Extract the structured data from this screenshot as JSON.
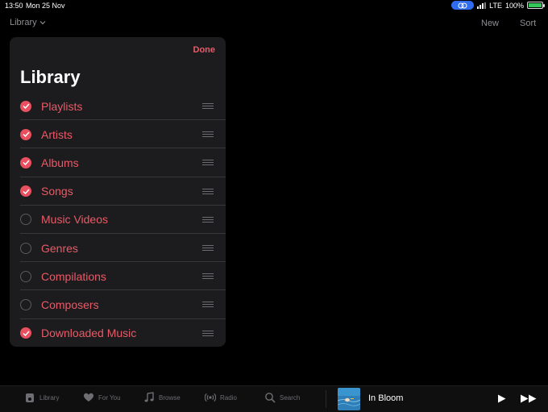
{
  "status": {
    "time": "13:50",
    "date": "Mon 25 Nov",
    "network": "LTE",
    "battery": "100%",
    "battery_level": 1.0
  },
  "nav": {
    "library": "Library",
    "new": "New",
    "sort": "Sort"
  },
  "popover": {
    "done": "Done",
    "title": "Library",
    "items": [
      {
        "label": "Playlists",
        "checked": true
      },
      {
        "label": "Artists",
        "checked": true
      },
      {
        "label": "Albums",
        "checked": true
      },
      {
        "label": "Songs",
        "checked": true
      },
      {
        "label": "Music Videos",
        "checked": false
      },
      {
        "label": "Genres",
        "checked": false
      },
      {
        "label": "Compilations",
        "checked": false
      },
      {
        "label": "Composers",
        "checked": false
      },
      {
        "label": "Downloaded Music",
        "checked": true
      }
    ]
  },
  "tabbar": {
    "tabs": [
      "Library",
      "For You",
      "Browse",
      "Radio",
      "Search"
    ],
    "now_playing": "In Bloom"
  },
  "colors": {
    "accent": "#e95a67",
    "background": "#000000",
    "panel": "#1c1c1e"
  }
}
